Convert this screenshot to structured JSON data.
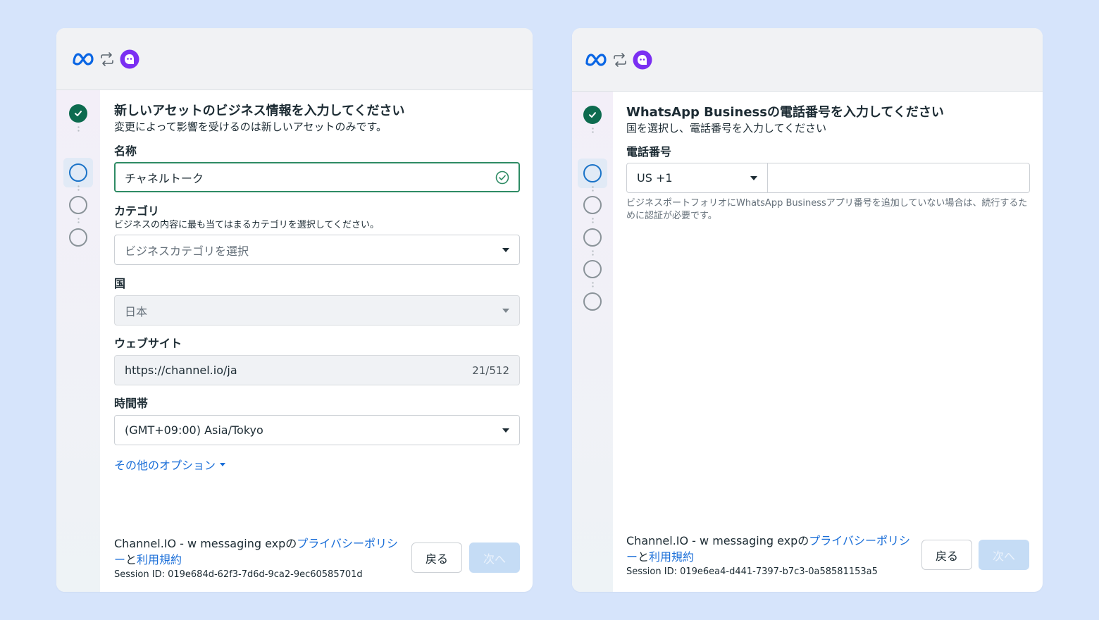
{
  "colors": {
    "background": "#d6e4fb",
    "done_step": "#0d6b4f",
    "current_step": "#1a73c8",
    "link": "#1a6ed8",
    "valid_border": "#2e8b64",
    "next_disabled": "#c5dcf5",
    "channel_logo": "#7b2ff2",
    "meta_logo": "#0a66e4"
  },
  "icons": {
    "meta_logo": "meta-logo-icon",
    "sync": "sync-arrows-icon",
    "channel_logo": "channel-talk-logo-icon",
    "check": "check-circle-icon",
    "caret": "chevron-down-icon"
  },
  "left_panel": {
    "title": "新しいアセットのビジネス情報を入力してください",
    "subtitle": "変更によって影響を受けるのは新しいアセットのみです。",
    "steps": [
      "done",
      "current",
      "open",
      "open"
    ],
    "name": {
      "label": "名称",
      "value": "チャネルトーク"
    },
    "category": {
      "label": "カテゴリ",
      "description": "ビジネスの内容に最も当てはまるカテゴリを選択してください。",
      "placeholder": "ビジネスカテゴリを選択"
    },
    "country": {
      "label": "国",
      "value": "日本"
    },
    "website": {
      "label": "ウェブサイト",
      "value": "https://channel.io/ja",
      "counter": "21/512"
    },
    "timezone": {
      "label": "時間帯",
      "value": "(GMT+09:00) Asia/Tokyo"
    },
    "more_options": "その他のオプション",
    "footer": {
      "prefix": "Channel.IO - w messaging expの",
      "privacy_link": "プライバシーポリシー",
      "connector": "と",
      "terms_link": "利用規約",
      "session": "Session ID: 019e684d-62f3-7d6d-9ca2-9ec60585701d"
    },
    "back_button": "戻る",
    "next_button": "次へ"
  },
  "right_panel": {
    "title": "WhatsApp Businessの電話番号を入力してください",
    "subtitle": "国を選択し、電話番号を入力してください",
    "steps": [
      "done",
      "current",
      "open",
      "open",
      "open",
      "open"
    ],
    "phone": {
      "label": "電話番号",
      "country_code": "US +1",
      "number": "",
      "hint": "ビジネスポートフォリオにWhatsApp Businessアプリ番号を追加していない場合は、続行するために認証が必要です。"
    },
    "footer": {
      "prefix": "Channel.IO - w messaging expの",
      "privacy_link": "プライバシーポリシー",
      "connector": "と",
      "terms_link": "利用規約",
      "session": "Session ID: 019e6ea4-d441-7397-b7c3-0a58581153a5"
    },
    "back_button": "戻る",
    "next_button": "次へ"
  }
}
